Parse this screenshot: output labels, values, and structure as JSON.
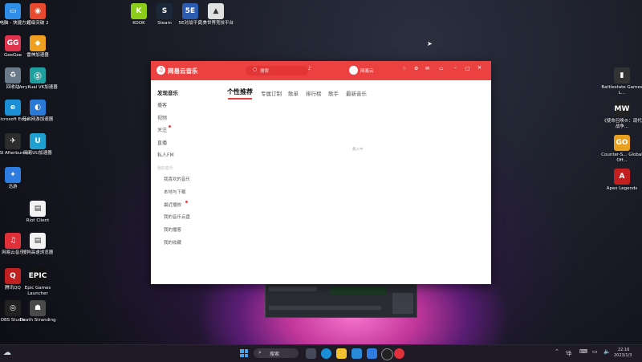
{
  "desktop": {
    "left_icons": [
      {
        "name": "icon-shortcut",
        "label": "此电脑 - 快捷方式",
        "color": "#2f8ee8",
        "glyph": "▭"
      },
      {
        "name": "icon-overwatch",
        "label": "超级突破 2",
        "color": "#e84a2f",
        "glyph": "◉"
      },
      {
        "name": "icon-geegee",
        "label": "GeeGee",
        "color": "#e0334d",
        "glyph": "GG"
      },
      {
        "name": "icon-leishen",
        "label": "雷神加速器",
        "color": "#f0a020",
        "glyph": "◆"
      },
      {
        "name": "icon-recycle",
        "label": "回收站",
        "color": "#6a7a8a",
        "glyph": "♻"
      },
      {
        "name": "icon-verykuai",
        "label": "VeryKuai VK加速器",
        "color": "#1fa0a0",
        "glyph": "Ⓢ"
      },
      {
        "name": "icon-edge",
        "label": "Microsoft Edge",
        "color": "#1b8fd6",
        "glyph": "e"
      },
      {
        "name": "icon-kaiyan",
        "label": "开启网游加速器",
        "color": "#2a7ad8",
        "glyph": "◐"
      },
      {
        "name": "icon-msi",
        "label": "MSI Afterburner",
        "color": "#2d2d2d",
        "glyph": "✈"
      },
      {
        "name": "icon-uu",
        "label": "网易UU加速器",
        "color": "#20a0d0",
        "glyph": "U"
      },
      {
        "name": "icon-feishu",
        "label": "迅游",
        "color": "#2f7ce0",
        "glyph": "✦"
      },
      {
        "name": "icon-riot",
        "label": "Riot Client",
        "color": "#f2f2f2",
        "glyph": "▤"
      },
      {
        "name": "icon-cloudmusic",
        "label": "网易云音乐",
        "color": "#e0303a",
        "glyph": "♫"
      },
      {
        "name": "icon-sougou",
        "label": "搜狗高速浏览器",
        "color": "#f2f2f2",
        "glyph": "▤"
      },
      {
        "name": "icon-tencentqq",
        "label": "腾讯QQ",
        "color": "#c02020",
        "glyph": "Q"
      },
      {
        "name": "icon-epic",
        "label": "Epic Games Launcher",
        "color": "#111111",
        "glyph": "EPIC"
      },
      {
        "name": "icon-obs",
        "label": "OBS Studio",
        "color": "#222222",
        "glyph": "◎"
      },
      {
        "name": "icon-death",
        "label": "Death Stranding",
        "color": "#4a4a4a",
        "glyph": "☗"
      }
    ],
    "top_icons": [
      {
        "name": "icon-kook",
        "label": "KOOK",
        "color": "#8ccc1a",
        "glyph": "K"
      },
      {
        "name": "icon-steam",
        "label": "Steam",
        "color": "#1b2838",
        "glyph": "S"
      },
      {
        "name": "icon-5e",
        "label": "5E对战平台",
        "color": "#2c5cb0",
        "glyph": "5E"
      },
      {
        "name": "icon-wanmei",
        "label": "完美世界竞技平台",
        "color": "#e0e0e0",
        "glyph": "▲"
      }
    ],
    "right_icons": [
      {
        "name": "icon-battlestate",
        "label": "Battlestate Games L...",
        "color": "#333",
        "glyph": "▮"
      },
      {
        "name": "icon-mw",
        "label": "《使命召唤®：现代战争...",
        "color": "#222",
        "glyph": "MW"
      },
      {
        "name": "icon-csgo",
        "label": "Counter-S... Global Off...",
        "color": "#e8a020",
        "glyph": "GO"
      },
      {
        "name": "icon-apex",
        "label": "Apex Legends",
        "color": "#c22020",
        "glyph": "A"
      }
    ]
  },
  "app": {
    "logo_text": "网易云音乐",
    "search_placeholder": "搜索",
    "mic_glyph": "🎙",
    "username": "网易云",
    "sidebar": {
      "discover": "发现音乐",
      "items": [
        "播客",
        "视频",
        "关注",
        "直播",
        "私人FM"
      ],
      "section": "我的音乐",
      "subitems": [
        "我喜欢的音乐",
        "本地与下载",
        "最近播放",
        "我的音乐云盘",
        "我的播客",
        "我的收藏"
      ]
    },
    "tabs": [
      "个性推荐",
      "专属订制",
      "歌单",
      "排行榜",
      "歌手",
      "最新音乐"
    ],
    "loading_text": "载入中"
  },
  "taskbar": {
    "search_label": "搜索",
    "ime_label": "中",
    "time": "22:16",
    "date": "2023/1/3"
  }
}
